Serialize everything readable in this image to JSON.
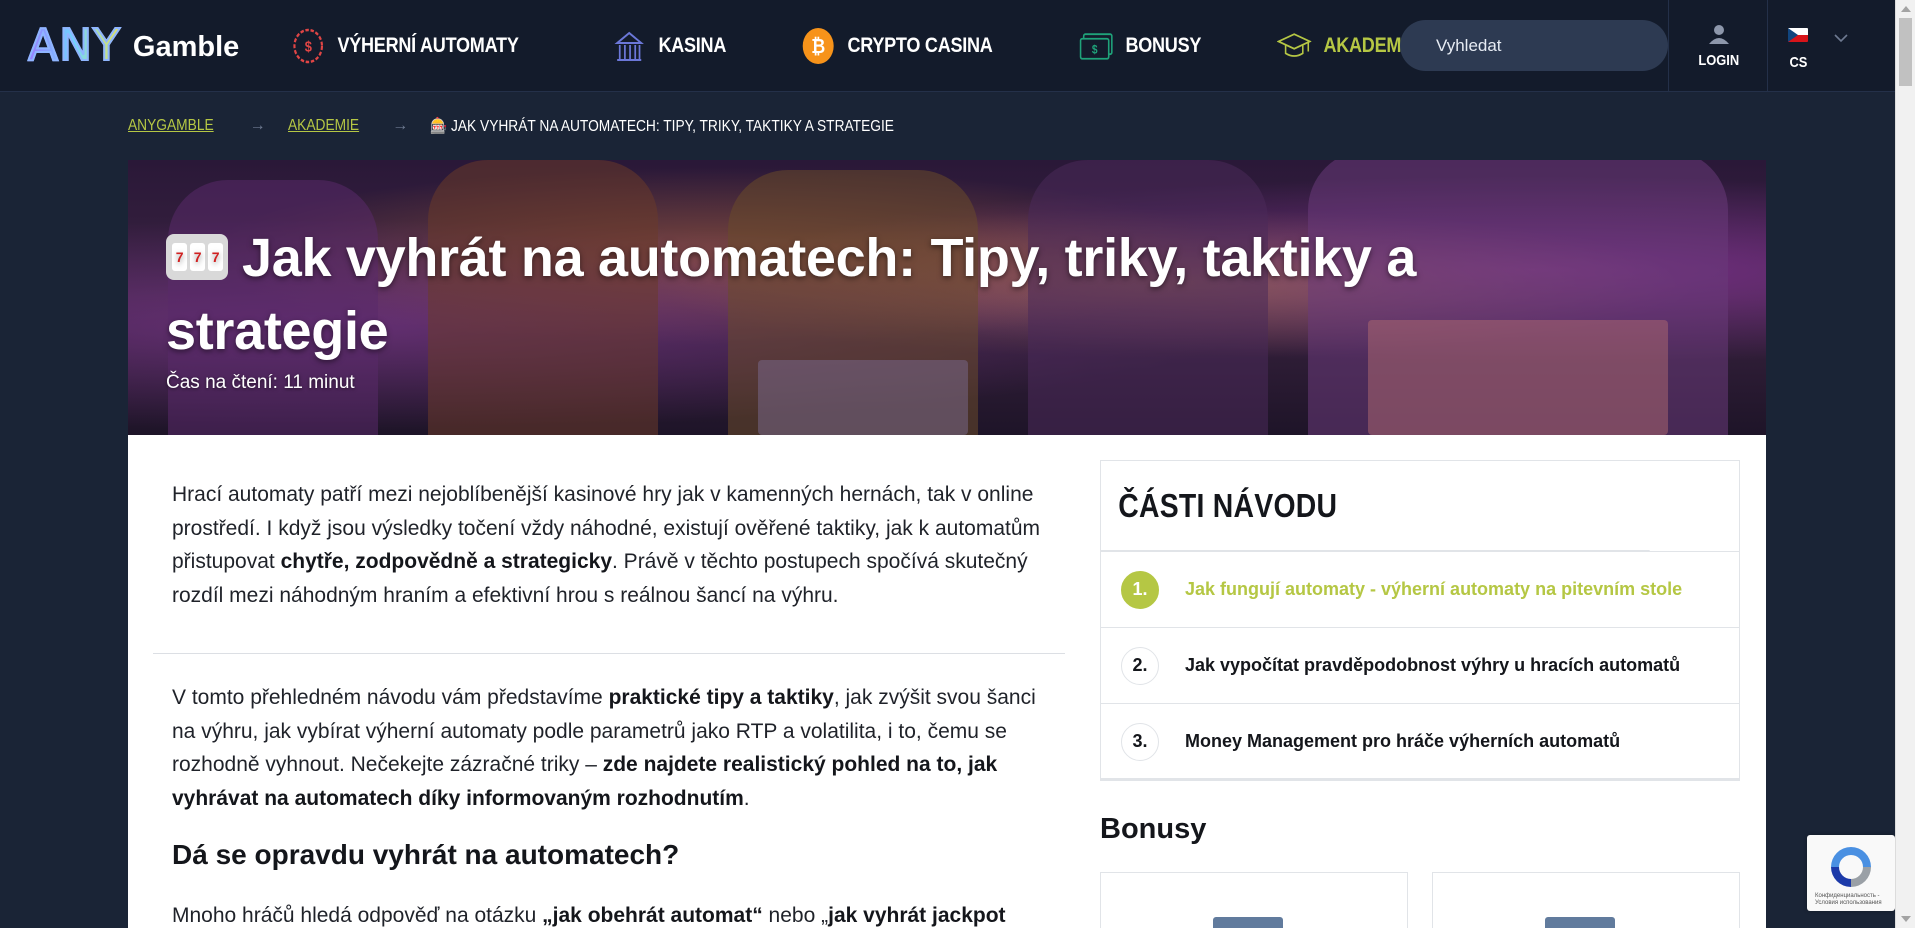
{
  "logo": {
    "any": "ANY",
    "gamble": "Gamble"
  },
  "nav": {
    "items": [
      {
        "label": "Výherní automaty",
        "icon": "slot-machine-icon",
        "active": false
      },
      {
        "label": "Kasina",
        "icon": "casino-building-icon",
        "active": false
      },
      {
        "label": "Crypto casina",
        "icon": "bitcoin-icon",
        "active": false
      },
      {
        "label": "Bonusy",
        "icon": "banknote-icon",
        "active": false
      },
      {
        "label": "Akademie",
        "icon": "graduation-cap-icon",
        "active": true
      }
    ],
    "search_placeholder": "Vyhledat",
    "login_label": "LOGIN",
    "language_code": "CS"
  },
  "breadcrumb": {
    "items": [
      "AnyGamble",
      "Akademie"
    ],
    "current": "🎰 Jak vyhrát na automatech: Tipy, triky, taktiky a strategie"
  },
  "hero": {
    "title": "Jak vyhrát na automatech: Tipy, triky, taktiky a strategie",
    "reading_time": "Čas na čtení: 11 minut"
  },
  "article": {
    "intro_parts": [
      "Hrací automaty patří mezi nejoblíbenější kasinové hry jak v kamenných hernách, tak v online prostředí. I když jsou výsledky točení vždy náhodné, existují ověřené taktiky, jak k automatům přistupovat ",
      "chytře, zodpovědně a strategicky",
      ". Právě v těchto postupech spočívá skutečný rozdíl mezi náhodným hraním a efektivní hrou s reálnou šancí na výhru."
    ],
    "para2_parts": [
      "V tomto přehledném návodu vám představíme ",
      "praktické tipy a taktiky",
      ", jak zvýšit svou šanci na výhru, jak vybírat výherní automaty podle parametrů jako RTP a volatilita, i to, čemu se rozhodně vyhnout. Nečekejte zázračné triky – ",
      "zde najdete realistický pohled na to, jak vyhrávat na automatech díky informovaným rozhodnutím",
      "."
    ],
    "heading": "Dá se opravdu vyhrát na automatech?",
    "para3_parts": [
      "Mnoho hráčů hledá odpověď na otázku ",
      "„jak obehrát automat“",
      " nebo „",
      "jak vyhrát jackpot"
    ]
  },
  "toc": {
    "title": "ČÁSTI NÁVODU",
    "items": [
      {
        "num": "1.",
        "label": "Jak fungují automaty - výherní automaty na pitevním stole",
        "active": true
      },
      {
        "num": "2.",
        "label": "Jak vypočítat pravděpodobnost výhry u hracích automatů",
        "active": false
      },
      {
        "num": "3.",
        "label": "Money Management pro hráče výherních automatů",
        "active": false
      }
    ]
  },
  "sidebar": {
    "bonusy_heading": "Bonusy"
  },
  "recaptcha": {
    "text": "Конфиденциальность - Условия использования"
  },
  "colors": {
    "accent": "#b5c744",
    "nav_bg": "#131b2b",
    "page_bg": "#1a2436"
  }
}
